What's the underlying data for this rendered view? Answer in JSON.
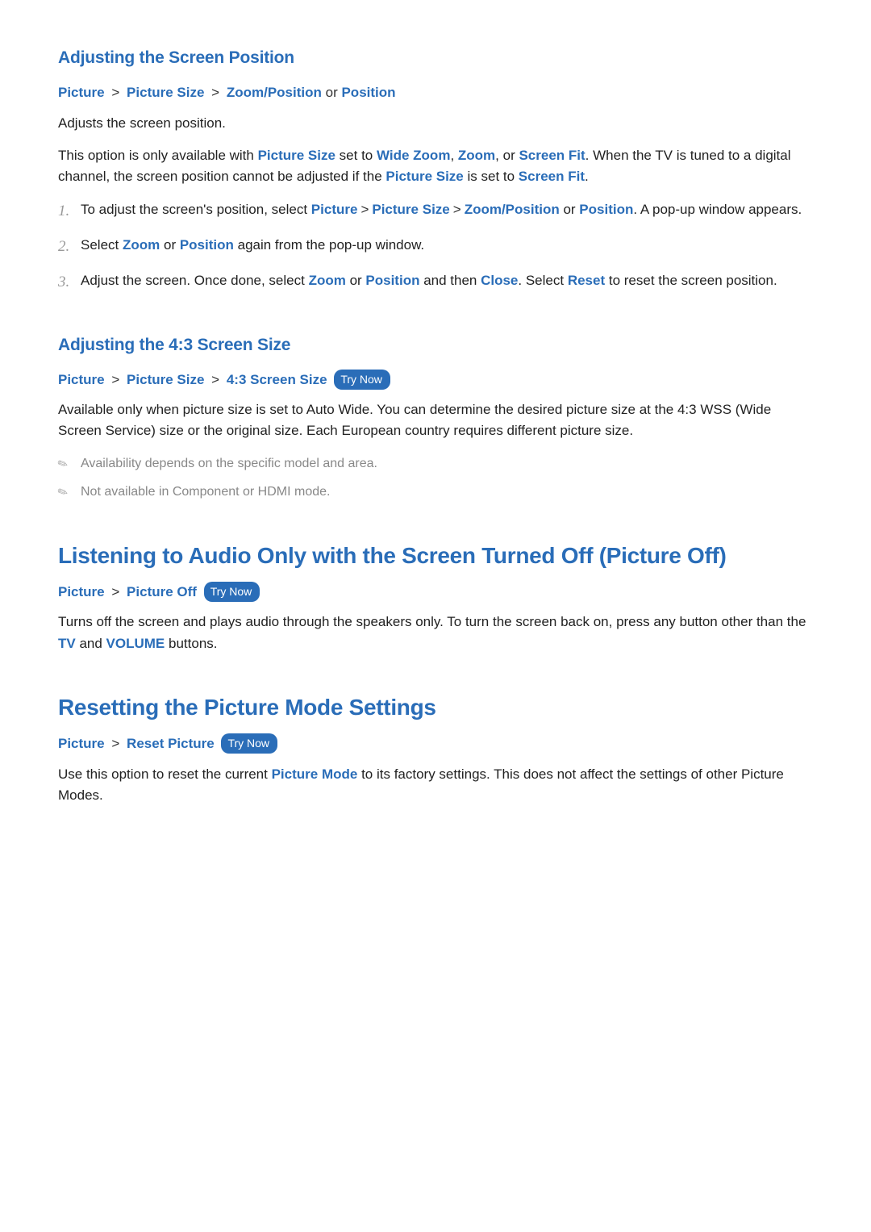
{
  "labels": {
    "try_now": "Try Now",
    "or": "or",
    "sep": ">"
  },
  "section1": {
    "heading": "Adjusting the Screen Position",
    "breadcrumb": {
      "a": "Picture",
      "b": "Picture Size",
      "c": "Zoom/Position",
      "d": "Position"
    },
    "p1": "Adjusts the screen position.",
    "p2_a": "This option is only available with ",
    "p2_link1": "Picture Size",
    "p2_b": " set to ",
    "p2_link2": "Wide Zoom",
    "p2_c": ", ",
    "p2_link3": "Zoom",
    "p2_d": ", or ",
    "p2_link4": "Screen Fit",
    "p2_e": ". When the TV is tuned to a digital channel, the screen position cannot be adjusted if the ",
    "p2_link5": "Picture Size",
    "p2_f": " is set to ",
    "p2_link6": "Screen Fit",
    "p2_g": ".",
    "step1_a": "To adjust the screen's position, select ",
    "step1_l1": "Picture",
    "step1_l2": "Picture Size",
    "step1_l3": "Zoom/Position",
    "step1_b": " or ",
    "step1_l4": "Position",
    "step1_c": ". A pop-up window appears.",
    "step2_a": "Select ",
    "step2_l1": "Zoom",
    "step2_b": " or ",
    "step2_l2": "Position",
    "step2_c": " again from the pop-up window.",
    "step3_a": "Adjust the screen. Once done, select ",
    "step3_l1": "Zoom",
    "step3_b": " or ",
    "step3_l2": "Position",
    "step3_c": " and then ",
    "step3_l3": "Close",
    "step3_d": ". Select ",
    "step3_l4": "Reset",
    "step3_e": " to reset the screen position."
  },
  "section2": {
    "heading": "Adjusting the 4:3 Screen Size",
    "breadcrumb": {
      "a": "Picture",
      "b": "Picture Size",
      "c": "4:3 Screen Size"
    },
    "p1": "Available only when picture size is set to Auto Wide. You can determine the desired picture size at the 4:3 WSS (Wide Screen Service) size or the original size. Each European country requires different picture size.",
    "note1": "Availability depends on the specific model and area.",
    "note2": "Not available in Component or HDMI mode."
  },
  "section3": {
    "heading": "Listening to Audio Only with the Screen Turned Off (Picture Off)",
    "breadcrumb": {
      "a": "Picture",
      "b": "Picture Off"
    },
    "p1_a": "Turns off the screen and plays audio through the speakers only. To turn the screen back on, press any button other than the ",
    "p1_l1": "TV",
    "p1_b": " and ",
    "p1_l2": "VOLUME",
    "p1_c": " buttons."
  },
  "section4": {
    "heading": "Resetting the Picture Mode Settings",
    "breadcrumb": {
      "a": "Picture",
      "b": "Reset Picture"
    },
    "p1_a": "Use this option to reset the current ",
    "p1_l1": "Picture Mode",
    "p1_b": " to its factory settings. This does not affect the settings of other Picture Modes."
  }
}
